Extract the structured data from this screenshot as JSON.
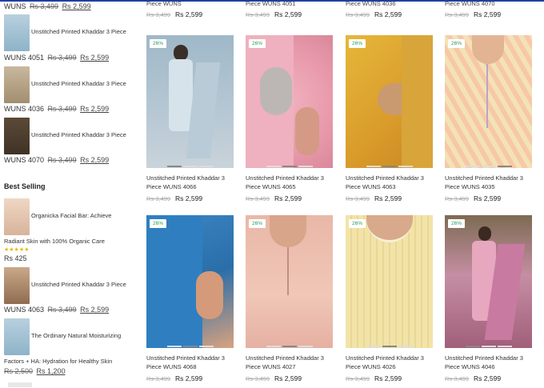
{
  "sidebar": {
    "top_price": {
      "sku": "WUNS",
      "old": "Rs 3,499",
      "new": "Rs 2,599"
    },
    "items": [
      {
        "title": "Unstitched Printed Khaddar 3 Piece",
        "sku": "WUNS 4051",
        "old": "Rs 3,499",
        "new": "Rs 2,599"
      },
      {
        "title": "Unstitched Printed Khaddar 3 Piece",
        "sku": "WUNS 4036",
        "old": "Rs 3,499",
        "new": "Rs 2,599"
      },
      {
        "title": "Unstitched Printed Khaddar 3 Piece",
        "sku": "WUNS 4070",
        "old": "Rs 3,499",
        "new": "Rs 2,599"
      }
    ],
    "best_selling_heading": "Best Selling",
    "best": [
      {
        "title1": "Organicka Facial Bar: Achieve",
        "title2": "Radiant Skin with 100% Organic Care",
        "stars": "★★★★★",
        "price": "Rs 425"
      },
      {
        "title": "Unstitched Printed Khaddar 3 Piece",
        "sku": "WUNS 4063",
        "old": "Rs 3,499",
        "new": "Rs 2,599"
      },
      {
        "title1": "The Ordinary Natural Moisturizing",
        "title2": "Factors + HA: Hydration for Healthy Skin",
        "old": "Rs 2,500",
        "new": "Rs 1,200"
      }
    ]
  },
  "top_row": [
    {
      "title": "Piece WUNS",
      "old": "Rs 3,499",
      "new": "Rs 2,599"
    },
    {
      "title": "Piece WUNS 4051",
      "old": "Rs 3,499",
      "new": "Rs 2,599"
    },
    {
      "title": "Piece WUNS 4036",
      "old": "Rs 3,499",
      "new": "Rs 2,599"
    },
    {
      "title": "Piece WUNS 4070",
      "old": "Rs 3,499",
      "new": "Rs 2,599"
    }
  ],
  "products": [
    {
      "badge": "26%",
      "title1": "Unstitched Printed Khaddar 3",
      "title2": "Piece WUNS 4066",
      "old": "Rs 3,499",
      "new": "Rs 2,599"
    },
    {
      "badge": "26%",
      "title1": "Unstitched Printed Khaddar 3",
      "title2": "Piece WUNS 4065",
      "old": "Rs 3,499",
      "new": "Rs 2,599"
    },
    {
      "badge": "26%",
      "title1": "Unstitched Printed Khaddar 3",
      "title2": "Piece WUNS 4063",
      "old": "Rs 3,499",
      "new": "Rs 2,599"
    },
    {
      "badge": "26%",
      "title1": "Unstitched Printed Khaddar 3",
      "title2": "Piece WUNS 4035",
      "old": "Rs 3,499",
      "new": "Rs 2,599"
    },
    {
      "badge": "26%",
      "title1": "Unstitched Printed Khaddar 3",
      "title2": "Piece WUNS 4068",
      "old": "Rs 3,499",
      "new": "Rs 2,599"
    },
    {
      "badge": "26%",
      "title1": "Unstitched Printed Khaddar 3",
      "title2": "Piece WUNS 4027",
      "old": "Rs 3,499",
      "new": "Rs 2,599"
    },
    {
      "badge": "26%",
      "title1": "Unstitched Printed Khaddar 3",
      "title2": "Piece WUNS 4026",
      "old": "Rs 3,499",
      "new": "Rs 2,599"
    },
    {
      "badge": "26%",
      "title1": "Unstitched Printed Khaddar 3",
      "title2": "Piece WUNS 4046",
      "old": "Rs 3,499",
      "new": "Rs 2,599"
    }
  ],
  "colors": {
    "badge_text": "#2d9a59",
    "rating_star": "#e6b800",
    "top_accent": "#1f3fa0"
  }
}
